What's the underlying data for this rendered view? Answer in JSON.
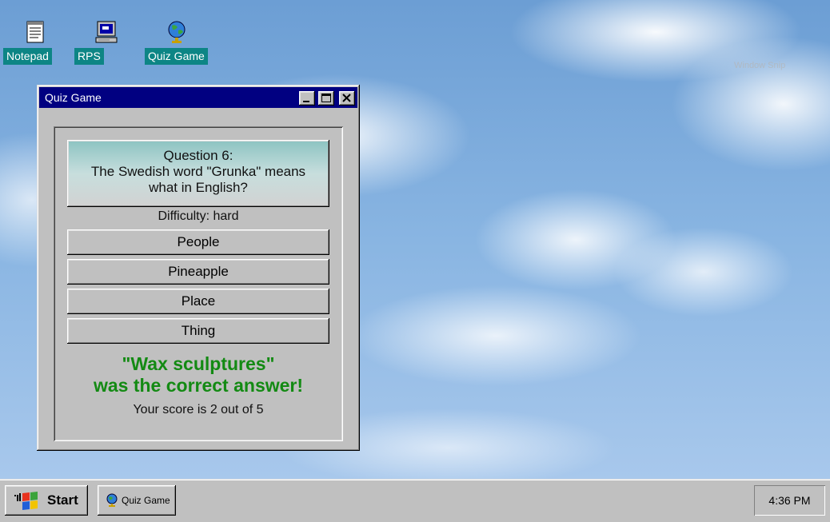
{
  "desktop": {
    "watermark": "Window Snip",
    "icons": [
      {
        "label": "Notepad",
        "icon": "notepad-icon"
      },
      {
        "label": "RPS",
        "icon": "computer-icon"
      },
      {
        "label": "Quiz Game",
        "icon": "globe-icon"
      }
    ]
  },
  "window": {
    "title": "Quiz Game",
    "controls": [
      "minimize",
      "maximize",
      "close"
    ],
    "question": {
      "line1": "Question 6:",
      "line2": "The Swedish word \"Grunka\" means",
      "line3": "what in English?"
    },
    "difficulty": "Difficulty: hard",
    "answers": [
      "People",
      "Pineapple",
      "Place",
      "Thing"
    ],
    "result": {
      "line1": "\"Wax sculptures\"",
      "line2": "was the correct answer!"
    },
    "score": "Your score is 2 out of 5"
  },
  "taskbar": {
    "start_label": "Start",
    "task_label": "Quiz Game",
    "clock": "4:36 PM"
  },
  "colors": {
    "titlebar": "#010081",
    "icon_label_bg": "#0d8585",
    "result_text": "#138a13",
    "chrome": "#c0c0c0"
  }
}
